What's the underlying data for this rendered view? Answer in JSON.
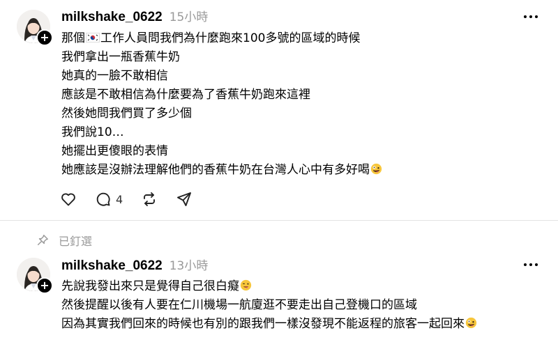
{
  "posts": [
    {
      "username": "milkshake_0622",
      "timestamp": "15小時",
      "lines": [
        "那個",
        "工作人員問我們為什麼跑來100多號的區域的時候",
        "我們拿出一瓶香蕉牛奶",
        "她真的一臉不敢相信",
        "應該是不敢相信為什麼要為了香蕉牛奶跑來這裡",
        "然後她問我們買了多少個",
        "我們說10…",
        "她擺出更傻眼的表情",
        "她應該是沒辦法理解他們的香蕉牛奶在台灣人心中有多好喝"
      ],
      "emojis": [
        "kr-flag-icon",
        "zany-face-emoji"
      ],
      "reply_count": "4"
    },
    {
      "pinned_label": "已釘選",
      "username": "milkshake_0622",
      "timestamp": "13小時",
      "lines": [
        "先說我發出來只是覺得自己很白癡",
        "然後提醒以後有人要在仁川機場一航廈逛不要走出自己登機口的區域",
        "因為其實我們回來的時候也有別的跟我們一樣沒發現不能返程的旅客一起回來"
      ],
      "emojis": [
        "tongue-wink-emoji",
        "zany-face-emoji"
      ]
    }
  ],
  "colors": {
    "text": "#000000",
    "muted": "#999999",
    "divider": "#e4e4e4",
    "background": "#ffffff"
  },
  "icons": [
    "avatar",
    "follow-plus-icon",
    "more-icon",
    "heart-icon",
    "comment-icon",
    "repost-icon",
    "share-icon",
    "pin-icon"
  ]
}
